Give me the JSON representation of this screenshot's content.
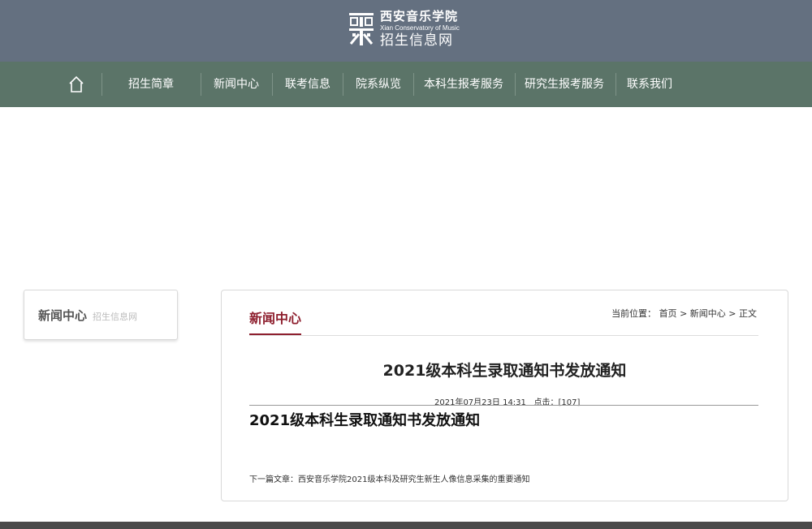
{
  "header": {
    "logo_cn": "西安音乐学院",
    "logo_en": "Xian Conservatory of Music",
    "logo_sub": "招生信息网",
    "bg_color": "#647080"
  },
  "nav": {
    "bg_color": "#5b7468",
    "home_icon": "home-icon",
    "items": [
      {
        "label": "招生简章"
      },
      {
        "label": "新闻中心"
      },
      {
        "label": "联考信息"
      },
      {
        "label": "院系纵览"
      },
      {
        "label": "本科生报考服务"
      },
      {
        "label": "研究生报考服务"
      },
      {
        "label": "联系我们"
      }
    ]
  },
  "sidebar": {
    "title": "新闻中心",
    "subtitle": "招生信息网"
  },
  "main": {
    "section_title": "新闻中心",
    "accent_color": "#8e1f2e",
    "breadcrumb": {
      "prefix": "当前位置：",
      "items": [
        "首页",
        "新闻中心",
        "正文"
      ],
      "separator": ">"
    },
    "article": {
      "title": "2021级本科生录取通知书发放通知",
      "date": "2021年07月23日 14:31",
      "clicks_label": "点击：",
      "clicks_value": "[107]",
      "body_heading": "2021级本科生录取通知书发放通知",
      "next_label": "下一篇文章：",
      "next_title": "西安音乐学院2021级本科及研究生新生人像信息采集的重要通知"
    }
  }
}
